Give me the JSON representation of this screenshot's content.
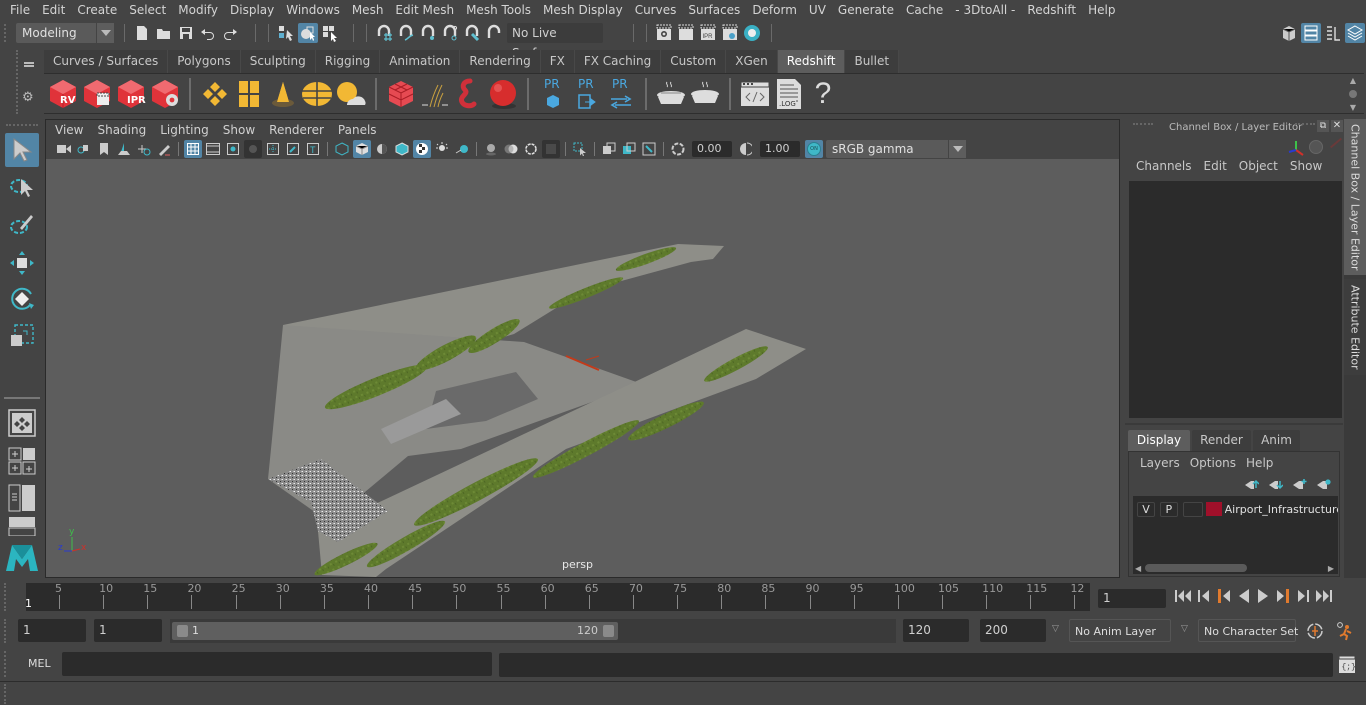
{
  "menubar": {
    "items": [
      "File",
      "Edit",
      "Create",
      "Select",
      "Modify",
      "Display",
      "Windows",
      "Mesh",
      "Edit Mesh",
      "Mesh Tools",
      "Mesh Display",
      "Curves",
      "Surfaces",
      "Deform",
      "UV",
      "Generate",
      "Cache",
      "- 3DtoAll -",
      "Redshift",
      "Help"
    ]
  },
  "statusline": {
    "menuset": "Modeling",
    "live_surface": "No Live Surface",
    "icons": {
      "file": [
        "new-scene-icon",
        "open-scene-icon",
        "save-scene-icon",
        "undo-icon",
        "redo-icon"
      ],
      "select_modes": [
        "select-by-hierarchy-icon",
        "select-by-object-icon",
        "select-by-component-icon"
      ],
      "snap": [
        "snap-to-grid-icon",
        "snap-to-curve-icon",
        "snap-to-point-icon",
        "snap-to-projected-center-icon",
        "snap-to-view-plane-icon",
        "make-live-icon"
      ],
      "render": [
        "render-view-icon",
        "render-current-frame-icon",
        "ipr-render-icon",
        "render-settings-icon",
        "hypershade-icon"
      ],
      "right": [
        "modeling-toolkit-icon",
        "channel-box-toggle-icon",
        "attribute-editor-toggle-icon",
        "layer-editor-toggle-icon"
      ]
    }
  },
  "shelf": {
    "tabs": [
      "Curves / Surfaces",
      "Polygons",
      "Sculpting",
      "Rigging",
      "Animation",
      "Rendering",
      "FX",
      "FX Caching",
      "Custom",
      "XGen",
      "Redshift",
      "Bullet"
    ],
    "active_tab": "Redshift",
    "buttons": [
      {
        "name": "redshift-render-view",
        "badge": "RV"
      },
      {
        "name": "redshift-batch-render",
        "badge": ""
      },
      {
        "name": "redshift-ipr",
        "badge": "IPR"
      },
      {
        "name": "redshift-render-settings",
        "badge": ""
      },
      {
        "name": "redshift-area-light",
        "badge": ""
      },
      {
        "name": "redshift-portal-light",
        "badge": ""
      },
      {
        "name": "redshift-ies-light",
        "badge": ""
      },
      {
        "name": "redshift-dome-light",
        "badge": ""
      },
      {
        "name": "redshift-sun-sky",
        "badge": ""
      },
      {
        "name": "redshift-proxy",
        "badge": ""
      },
      {
        "name": "redshift-hair",
        "badge": ""
      },
      {
        "name": "redshift-volume",
        "badge": ""
      },
      {
        "name": "redshift-material",
        "badge": ""
      },
      {
        "name": "redshift-pr-import",
        "badge": "PR"
      },
      {
        "name": "redshift-pr-export",
        "badge": "PR"
      },
      {
        "name": "redshift-pr-transfer",
        "badge": "PR"
      },
      {
        "name": "redshift-bake",
        "badge": ""
      },
      {
        "name": "redshift-bake-set",
        "badge": ""
      },
      {
        "name": "redshift-script-editor",
        "badge": ""
      },
      {
        "name": "redshift-log",
        "badge": ".LOG"
      },
      {
        "name": "redshift-help",
        "badge": "?"
      }
    ]
  },
  "toolbox": {
    "tools": [
      "select-tool",
      "lasso-tool",
      "paint-select-tool",
      "move-tool",
      "rotate-tool",
      "scale-tool"
    ],
    "layouts": [
      "single-perspective-layout",
      "four-view-layout",
      "outliner-perspective-layout",
      "perspective-graph-layout"
    ]
  },
  "viewport": {
    "menus": [
      "View",
      "Shading",
      "Lighting",
      "Show",
      "Renderer",
      "Panels"
    ],
    "exposure": "0.00",
    "gamma": "1.00",
    "color_management_toggle": "ON",
    "view_transform": "sRGB gamma",
    "camera_label": "persp",
    "axis": {
      "x": "x",
      "y": "y",
      "z": "z"
    },
    "scene_object": "Airport_Infrastructure"
  },
  "channel_box": {
    "title": "Channel Box / Layer Editor",
    "menus": [
      "Channels",
      "Edit",
      "Object",
      "Show"
    ]
  },
  "layer_editor": {
    "tabs": [
      "Display",
      "Render",
      "Anim"
    ],
    "active_tab": "Display",
    "menus": [
      "Layers",
      "Options",
      "Help"
    ],
    "layers": [
      {
        "visible": "V",
        "playback": "P",
        "color": "#a0102a",
        "name": "Airport_Infrastructure_"
      }
    ]
  },
  "side_tabs": {
    "channel_box": "Channel Box / Layer Editor",
    "attribute_editor": "Attribute Editor"
  },
  "timeline": {
    "ticks": [
      "5",
      "10",
      "15",
      "20",
      "25",
      "30",
      "35",
      "40",
      "45",
      "50",
      "55",
      "60",
      "65",
      "70",
      "75",
      "80",
      "85",
      "90",
      "95",
      "100",
      "105",
      "110",
      "115",
      "12"
    ],
    "current_frame_marker": "1",
    "current_frame": "1"
  },
  "range": {
    "start": "1",
    "playback_start": "1",
    "slider_min": "1",
    "slider_max": "120",
    "playback_end": "120",
    "end": "200",
    "anim_layer": "No Anim Layer",
    "character_set": "No Character Set"
  },
  "command_line": {
    "language": "MEL",
    "input": "",
    "result": ""
  },
  "colors": {
    "accent": "#5285a6",
    "teal": "#3fb8c8",
    "redshift_red": "#e0333a",
    "light_yellow": "#f2b834",
    "key_orange": "#e07a2e"
  }
}
